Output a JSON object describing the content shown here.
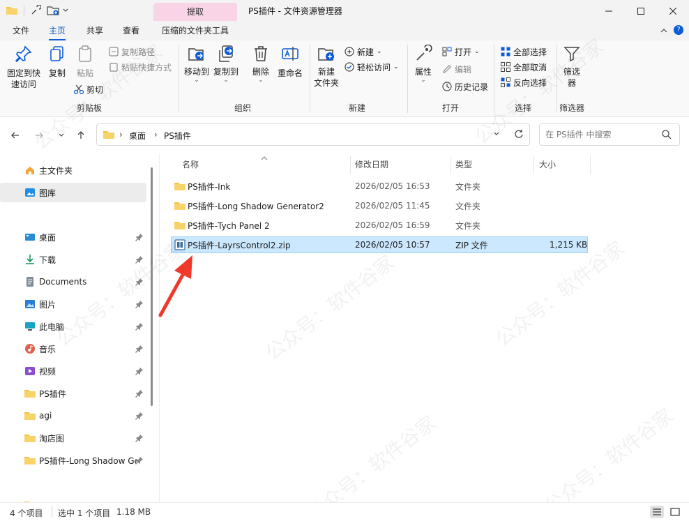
{
  "window": {
    "title": "PS插件 - 文件资源管理器",
    "context_tab": "提取"
  },
  "ribbon_tabs": [
    "文件",
    "主页",
    "共享",
    "查看",
    "压缩的文件夹工具"
  ],
  "ribbon": {
    "clipboard": {
      "pin_label": "固定到快\n速访问",
      "copy": "复制",
      "paste": "粘贴",
      "copy_path": "复制路径",
      "paste_shortcut": "粘贴快捷方式",
      "cut": "剪切",
      "group": "剪贴板"
    },
    "organize": {
      "move_to": "移动到",
      "copy_to": "复制到",
      "delete": "删除",
      "rename": "重命名",
      "group": "组织"
    },
    "new": {
      "new_folder": "新建\n文件夹",
      "new_item": "新建",
      "easy_access": "轻松访问",
      "group": "新建"
    },
    "open": {
      "properties": "属性",
      "open": "打开",
      "edit": "编辑",
      "history": "历史记录",
      "group": "打开"
    },
    "select": {
      "select_all": "全部选择",
      "select_none": "全部取消",
      "invert": "反向选择",
      "group": "选择"
    },
    "filter": {
      "filter": "筛选\n器",
      "group": "筛选器"
    }
  },
  "address": {
    "crumbs": [
      "桌面",
      "PS插件"
    ],
    "search_placeholder": "在 PS插件 中搜索"
  },
  "sidebar": {
    "items": [
      {
        "label": "主文件夹",
        "icon": "home-icon"
      },
      {
        "label": "图库",
        "icon": "gallery-icon"
      },
      {
        "label": "桌面",
        "icon": "desktop-icon"
      },
      {
        "label": "下载",
        "icon": "download-icon"
      },
      {
        "label": "Documents",
        "icon": "documents-icon"
      },
      {
        "label": "图片",
        "icon": "pictures-icon"
      },
      {
        "label": "此电脑",
        "icon": "computer-icon"
      },
      {
        "label": "音乐",
        "icon": "music-icon"
      },
      {
        "label": "视频",
        "icon": "video-icon"
      },
      {
        "label": "PS插件",
        "icon": "folder-icon"
      },
      {
        "label": "agi",
        "icon": "folder-icon"
      },
      {
        "label": "淘店图",
        "icon": "folder-icon"
      },
      {
        "label": "PS插件-Long Shadow Ge",
        "icon": "folder-icon"
      }
    ]
  },
  "columns": {
    "name": "名称",
    "modified": "修改日期",
    "type": "类型",
    "size": "大小"
  },
  "files": [
    {
      "name": "PS插件-Ink",
      "modified": "2026/02/05 16:53",
      "type": "文件夹",
      "size": "",
      "icon": "folder-icon"
    },
    {
      "name": "PS插件-Long Shadow Generator2",
      "modified": "2026/02/05 11:45",
      "type": "文件夹",
      "size": "",
      "icon": "folder-icon"
    },
    {
      "name": "PS插件-Tych Panel 2",
      "modified": "2026/02/05 16:59",
      "type": "文件夹",
      "size": "",
      "icon": "folder-icon"
    },
    {
      "name": "PS插件-LayrsControl2.zip",
      "modified": "2026/02/05 10:57",
      "type": "ZIP 文件",
      "size": "1,215 KB",
      "icon": "zip-archive-icon"
    }
  ],
  "status": {
    "item_count": "4 个项目",
    "selection": "选中 1 个项目",
    "selection_size": "1.18 MB"
  },
  "watermark": "公众号：软件谷家",
  "colors": {
    "accent": "#0b5cd6",
    "selection": "#cce8ff",
    "context_tab": "#f9d4e6",
    "folder": "#f6c342",
    "arrow": "#f0392b"
  }
}
